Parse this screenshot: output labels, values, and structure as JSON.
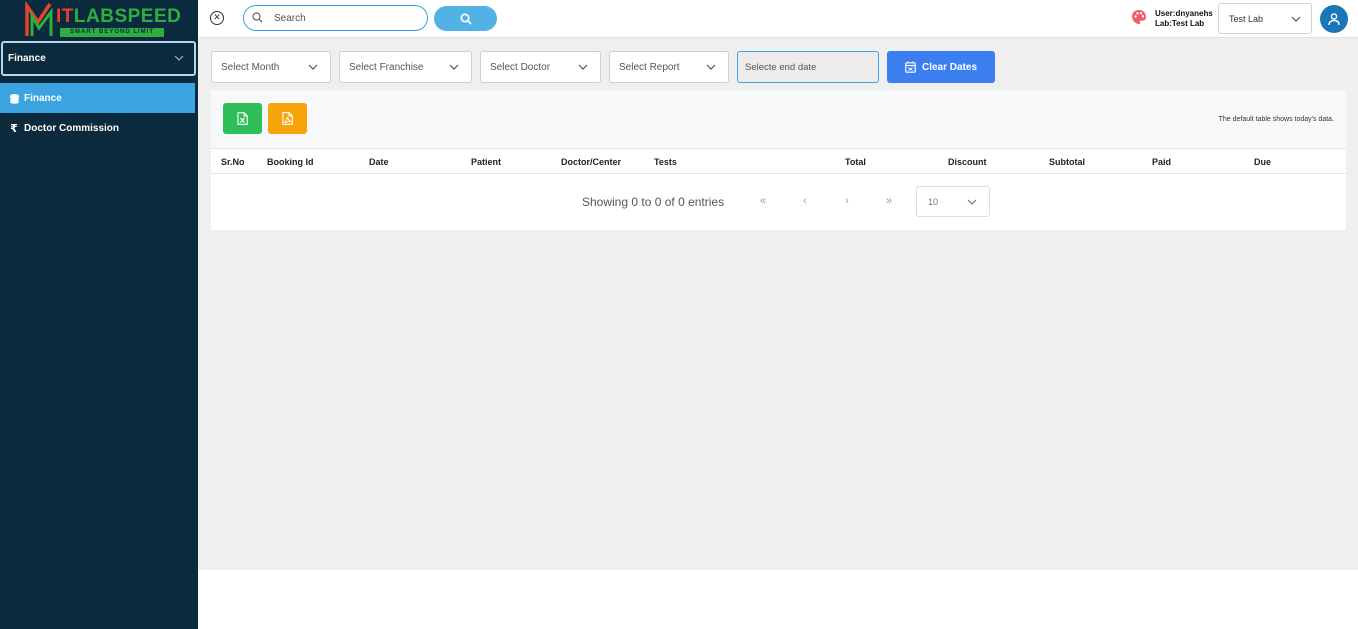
{
  "brand": {
    "name_part1": "IT",
    "name_part2": "LABSPEED",
    "tagline": "SMART BEYOND LIMIT"
  },
  "sidebar": {
    "module": "Finance",
    "items": [
      {
        "label": "Finance",
        "icon": "coins-icon",
        "active": true
      },
      {
        "label": "Doctor Commission",
        "icon": "rupee-icon",
        "active": false
      }
    ]
  },
  "topbar": {
    "search_placeholder": "Search",
    "user_line": "User:dnyanehs",
    "lab_line": "Lab:Test Lab",
    "lab_select": "Test Lab"
  },
  "filters": {
    "month": "Select Month",
    "franchise": "Select Franchise",
    "doctor": "Select Doctor",
    "report": "Select Report",
    "end_date_placeholder": "Selecte end date",
    "clear_label": "Clear Dates"
  },
  "table": {
    "note": "The default table shows today's data.",
    "columns": [
      "Sr.No",
      "Booking Id",
      "Date",
      "Patient",
      "Doctor/Center",
      "Tests",
      "Total",
      "Discount",
      "Subtotal",
      "Paid",
      "Due"
    ],
    "rows": []
  },
  "pagination": {
    "showing": "Showing 0 to 0 of 0 entries",
    "first": "«",
    "prev": "‹",
    "next": "›",
    "last": "»",
    "per_page": "10"
  },
  "colors": {
    "sidebar_bg": "#0b2a3e",
    "active_nav": "#3aa3e0",
    "clear_btn": "#3a7ef0",
    "excel_btn": "#2fbe5a",
    "pdf_btn": "#f5a40c",
    "avatar": "#1976b8"
  }
}
